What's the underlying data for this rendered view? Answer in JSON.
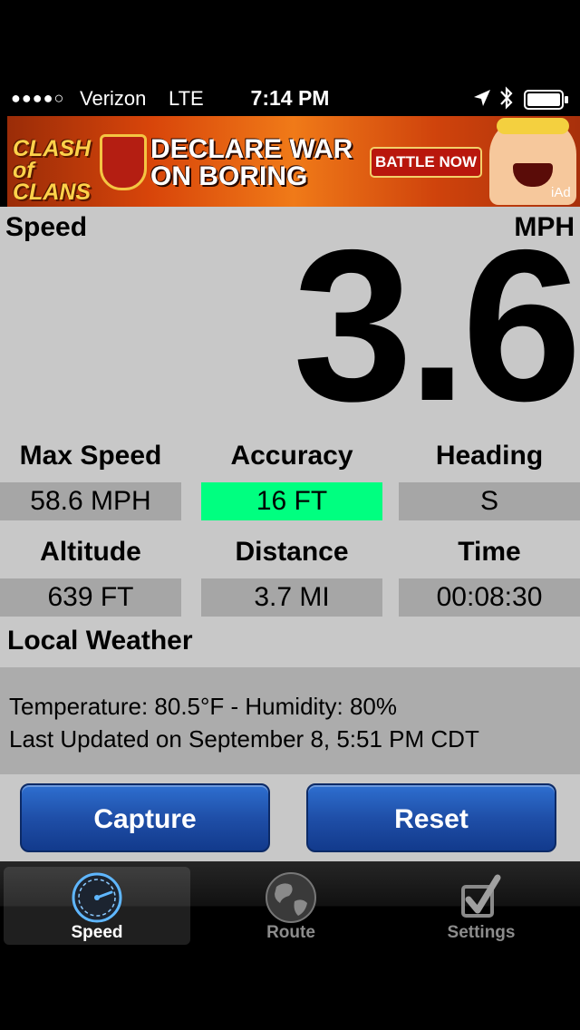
{
  "status_bar": {
    "signal_dots": "●●●●○",
    "carrier": "Verizon",
    "network": "LTE",
    "time": "7:14 PM",
    "icons": [
      "location-arrow-icon",
      "bluetooth-icon",
      "battery-icon"
    ]
  },
  "ad": {
    "logo_text": "CLASH of CLANS",
    "headline": "DECLARE WAR ON BORING",
    "cta": "BATTLE NOW",
    "badge": "iAd"
  },
  "speed": {
    "label": "Speed",
    "unit": "MPH",
    "value": "3.6"
  },
  "stats": {
    "max_speed": {
      "label": "Max Speed",
      "value": "58.6 MPH"
    },
    "accuracy": {
      "label": "Accuracy",
      "value": "16 FT",
      "highlight_color": "#00ff80"
    },
    "heading": {
      "label": "Heading",
      "value": "S"
    },
    "altitude": {
      "label": "Altitude",
      "value": "639 FT"
    },
    "distance": {
      "label": "Distance",
      "value": "3.7 MI"
    },
    "time": {
      "label": "Time",
      "value": "00:08:30"
    }
  },
  "weather": {
    "title": "Local Weather",
    "line1": "Temperature: 80.5°F - Humidity: 80%",
    "line2": "Last Updated on September 8, 5:51 PM CDT"
  },
  "buttons": {
    "capture": "Capture",
    "reset": "Reset",
    "color": "#1f4fa8"
  },
  "tabs": [
    {
      "label": "Speed",
      "icon": "speedometer-icon",
      "selected": true
    },
    {
      "label": "Route",
      "icon": "globe-icon",
      "selected": false
    },
    {
      "label": "Settings",
      "icon": "checkbox-check-icon",
      "selected": false
    }
  ]
}
